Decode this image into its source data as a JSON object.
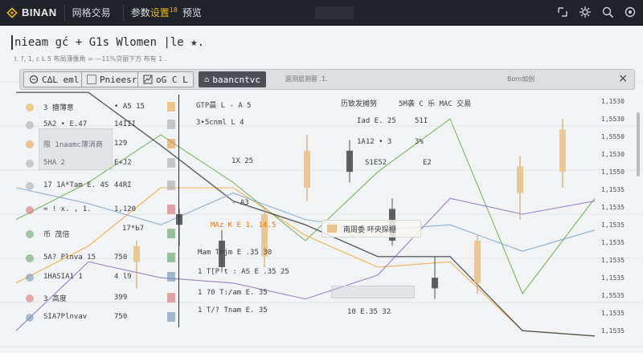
{
  "topbar": {
    "logo_text": "BINAN",
    "nav_link": "网格交易",
    "tab_prefix": "参数",
    "tab_accent": "设置",
    "tab_num": "18",
    "tab_suffix": "预览",
    "icons": [
      "expand-icon",
      "gear-icon",
      "search-icon",
      "settings-icon"
    ]
  },
  "header": {
    "title": "nieam  gć  +  G1s  Wlomen  |le  ★.",
    "subtitle": "I. ?, 1, c L 5  布局薄像角 =  —11%贷丽下方 布有  1 ."
  },
  "tab_strip": {
    "tabs": [
      {
        "label": "C∆L eml",
        "icon": "coin-icon"
      },
      {
        "label": "Pnieesr",
        "icon": "blank-icon"
      },
      {
        "label": "oG C L",
        "icon": "chart-icon"
      },
      {
        "label": "baancntvc",
        "icon": "home-icon"
      }
    ],
    "note_left": "面测层测蓉  .1.",
    "note_right": "Bom加创",
    "close": "×"
  },
  "table": {
    "rows": [
      {
        "name": "3 搪薄意",
        "value": "• A5  15",
        "icon_color": "#e7a93c"
      },
      {
        "name": "5A2 • E.47",
        "value": "14III",
        "icon_color": "#a6a9ad"
      },
      {
        "name": "限  1naamc薄消商",
        "value": "129",
        "icon_color": "#e39a3c"
      },
      {
        "name": "5HA 2",
        "value": "E+J2",
        "icon_color": "#a6a9ad"
      },
      {
        "name": "17  1A*Tam  E. 4S",
        "value": "44RI",
        "icon_color": "#a6a9ad"
      },
      {
        "name": "=  ! x. ,  1.",
        "value": "1,120",
        "icon_color": "#d96a6a"
      },
      {
        "name": "币 茂倍",
        "value": "",
        "icon_color": "#5aa05a"
      },
      {
        "name": "5A? Plnva 15",
        "value": "750",
        "icon_color": "#5aa05a"
      },
      {
        "name": "1HASIA1  1",
        "value": "4 l9",
        "icon_color": "#6a8fb0"
      },
      {
        "name": "3  高度",
        "value": "399",
        "icon_color": "#d96a6a"
      },
      {
        "name": "SIA7Plnvav",
        "value": "750",
        "icon_color": "#6a8fb0"
      }
    ],
    "extra_label": "17*Ь7",
    "mid_rows": [
      {
        "text": "GTP晨 L - A 5",
        "accent": ".1"
      },
      {
        "text": "3•5cnml L 4",
        "accent": ""
      },
      {
        "text": "1X 25",
        "accent": ""
      },
      {
        "text": "- A3",
        "accent": ""
      },
      {
        "text": "MAz K E   1. 14.5",
        "accent": "1. 14.5"
      },
      {
        "text": "Mam Tnjm  E .35   30",
        "accent": ""
      },
      {
        "text": "1 T[P t : AS  E .35   25",
        "accent": ""
      },
      {
        "text": "1 ?0  T:/am  E. 35",
        "accent": ""
      },
      {
        "text": "1 T/? Tnam  E. 35",
        "accent": ""
      }
    ],
    "right_rows": [
      {
        "text": "历致发摊努",
        "extra": "5M袭 C  乐 MAC 交易"
      },
      {
        "text": "Iad E. 25",
        "extra": "51I"
      },
      {
        "text": "1A12 • 3",
        "extra": "3%"
      },
      {
        "text": "S1E52",
        "extra": "E2"
      },
      {
        "text": "10 E.35   32",
        "extra": ""
      }
    ]
  },
  "pill": {
    "label": "南周委 吥央探棚"
  },
  "axis": {
    "labels": [
      "1,1530",
      "1,5530",
      "1,5550",
      "1,1530",
      "1,1550",
      "1,1535",
      "1,1535",
      "1,1535",
      "1,1535",
      "1,1535",
      "1,1535",
      "1,5535",
      "1,1535",
      "1,1535"
    ]
  },
  "colors": {
    "accent": "#f0b90b",
    "up": "#e9c48c",
    "down": "#4d5257",
    "bear": "#d96a6a"
  },
  "chart_data": {
    "type": "line",
    "series": [
      {
        "color": "#6aa84f",
        "values": [
          0.48,
          0.62,
          0.8,
          0.62,
          0.4,
          0.66,
          0.86,
          0.2,
          0.56
        ]
      },
      {
        "color": "#e7a93c",
        "values": [
          0.24,
          0.38,
          0.6,
          0.6,
          0.42,
          0.3,
          0.32,
          0.06,
          0.04
        ]
      },
      {
        "color": "#3f4348",
        "values": [
          0.96,
          0.96,
          0.76,
          0.55,
          0.46,
          0.34,
          0.34,
          0.06,
          0.04
        ]
      },
      {
        "color": "#8b6fb8",
        "values": [
          0.06,
          0.32,
          0.26,
          0.24,
          0.18,
          0.27,
          0.56,
          0.5,
          0.55
        ]
      },
      {
        "color": "#7fa3c4",
        "values": [
          0.6,
          0.54,
          0.46,
          0.58,
          0.48,
          0.44,
          0.46,
          0.36,
          0.44
        ]
      }
    ],
    "candles": [
      {
        "o": 0.32,
        "h": 0.4,
        "l": 0.22,
        "c": 0.38
      },
      {
        "o": 0.5,
        "h": 0.52,
        "l": 0.38,
        "c": 0.46
      },
      {
        "o": 0.4,
        "h": 0.44,
        "l": 0.28,
        "c": 0.3
      },
      {
        "o": 0.34,
        "h": 0.52,
        "l": 0.3,
        "c": 0.5
      },
      {
        "o": 0.6,
        "h": 0.8,
        "l": 0.55,
        "c": 0.74
      },
      {
        "o": 0.74,
        "h": 0.78,
        "l": 0.62,
        "c": 0.66
      },
      {
        "o": 0.52,
        "h": 0.56,
        "l": 0.38,
        "c": 0.4
      },
      {
        "o": 0.26,
        "h": 0.34,
        "l": 0.18,
        "c": 0.22
      },
      {
        "o": 0.24,
        "h": 0.42,
        "l": 0.2,
        "c": 0.4
      },
      {
        "o": 0.58,
        "h": 0.72,
        "l": 0.48,
        "c": 0.68
      },
      {
        "o": 0.66,
        "h": 0.86,
        "l": 0.6,
        "c": 0.82
      }
    ]
  }
}
